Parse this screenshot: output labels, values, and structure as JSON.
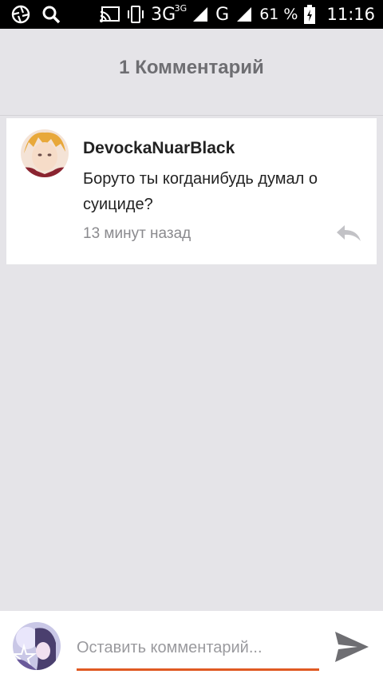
{
  "status_bar": {
    "network_type": "3G",
    "network_sup": "3G",
    "network_g": "G",
    "battery_percent": "61 %",
    "time": "11:16",
    "icons": [
      "aperture-icon",
      "search-icon",
      "cast-icon",
      "vibrate-icon",
      "signal-icon",
      "battery-icon"
    ]
  },
  "header": {
    "title": "1 Комментарий"
  },
  "comments": [
    {
      "author": "DevockaNuarBlack",
      "text": "Боруто ты когданибудь думал о суициде?",
      "time_ago": "13 минут назад"
    }
  ],
  "composer": {
    "placeholder": "Оставить комментарий...",
    "value": ""
  },
  "colors": {
    "background": "#e5e4e8",
    "accent": "#e05a23",
    "card": "#ffffff"
  }
}
